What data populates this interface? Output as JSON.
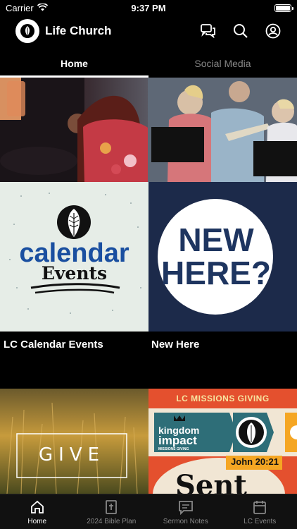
{
  "status_bar": {
    "carrier": "Carrier",
    "time": "9:37 PM",
    "battery_level": 1.0
  },
  "header": {
    "title": "Life Church",
    "icons": [
      "leaf-logo-icon",
      "chat-icon",
      "search-icon",
      "profile-icon"
    ]
  },
  "tabs": [
    {
      "label": "Home",
      "active": true
    },
    {
      "label": "Social Media",
      "active": false
    }
  ],
  "tiles": [
    {
      "label": "LC Calendar Events",
      "art": {
        "word1": "calendar",
        "word2": "Events"
      }
    },
    {
      "label": "New Here",
      "art": {
        "line1": "NEW",
        "line2": "HERE?"
      }
    },
    {
      "label": "",
      "art": {
        "text": "GIVE"
      }
    },
    {
      "label": "",
      "art": {
        "banner": "LC MISSIONS GIVING",
        "line1": "kingdom",
        "line2": "impact",
        "line3": "MISSIONS GIVING",
        "verse": "John 20:21",
        "partial": "Sent"
      }
    }
  ],
  "tab_bar": [
    {
      "label": "Home",
      "icon": "home-icon",
      "active": true
    },
    {
      "label": "2024 Bible Plan",
      "icon": "bible-icon",
      "active": false
    },
    {
      "label": "Sermon Notes",
      "icon": "notes-icon",
      "active": false
    },
    {
      "label": "LC Events",
      "icon": "calendar-icon",
      "active": false
    }
  ],
  "colors": {
    "background": "#000000",
    "new_here_bg": "#1c2a4a",
    "navy": "#1e3560",
    "calendar_blue": "#1a4fa0",
    "missions_red": "#e4502e",
    "missions_teal": "#2e6e78",
    "missions_yellow": "#f5a623"
  }
}
